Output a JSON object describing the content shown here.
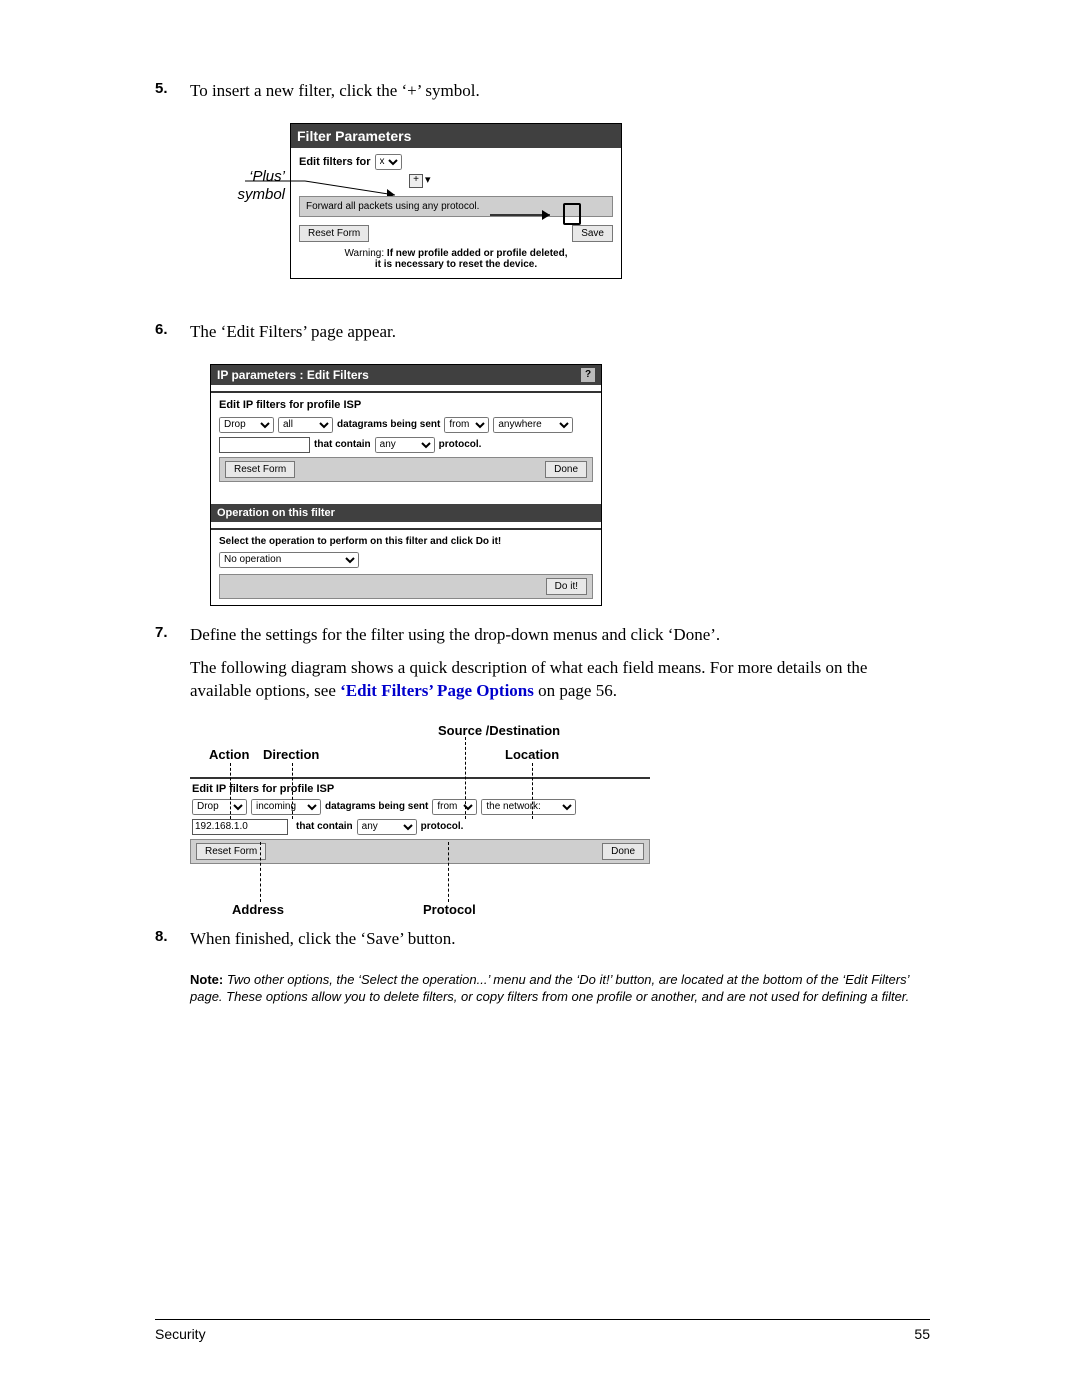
{
  "steps": {
    "s5": {
      "num": "5.",
      "text": "To insert a new filter, click the ‘+’ symbol."
    },
    "s6": {
      "num": "6.",
      "text": "The ‘Edit Filters’ page appear."
    },
    "s7": {
      "num": "7.",
      "text1": "Define the settings for the filter using the drop-down menus and click ‘Done’.",
      "text2a": "The following diagram shows a quick description of what each field means. For more details on the available options, see ",
      "link": "‘Edit Filters’ Page Options",
      "text2b": " on page 56."
    },
    "s8": {
      "num": "8.",
      "text": "When finished, click the ‘Save’ button."
    }
  },
  "fig1": {
    "callout_line1": "‘Plus’",
    "callout_line2": "symbol",
    "panel_title": "Filter Parameters",
    "edit_filters_for": "Edit filters for",
    "edit_select_value": "x",
    "plus": "+",
    "gray_text": "Forward all packets using any protocol.",
    "reset_btn": "Reset Form",
    "save_btn": "Save",
    "warn_label": "Warning:",
    "warn_line1": "If new profile added or profile deleted,",
    "warn_line2": "it is necessary to reset the device."
  },
  "fig2": {
    "title": "IP parameters : Edit Filters",
    "help": "?",
    "heading": "Edit IP filters for profile ISP",
    "action_value": "Drop",
    "dir_value": "all",
    "dgs": "datagrams being sent",
    "fromto_value": "from",
    "loc_value": "anywhere",
    "addr_value": "",
    "that_contain": "that contain",
    "proto_value": "any",
    "proto_label": "protocol.",
    "reset_btn": "Reset Form",
    "done_btn": "Done",
    "op_header": "Operation on this filter",
    "op_instr": "Select the operation to perform on this filter and click Do it!",
    "op_value": "No operation",
    "doit_btn": "Do it!"
  },
  "fig3": {
    "lbl_action": "Action",
    "lbl_direction": "Direction",
    "lbl_srcdst": "Source /Destination",
    "lbl_location": "Location",
    "lbl_address": "Address",
    "lbl_protocol": "Protocol",
    "heading": "Edit IP filters for profile ISP",
    "action_value": "Drop",
    "dir_value": "incoming",
    "dgs": "datagrams being sent",
    "fromto_value": "from",
    "loc_value": "the network:",
    "addr_value": "192.168.1.0",
    "that_contain": "that contain",
    "proto_value": "any",
    "proto_label": "protocol.",
    "reset_btn": "Reset Form",
    "done_btn": "Done"
  },
  "note": {
    "label": "Note:",
    "text": "Two other options, the ‘Select the operation...’ menu and the ‘Do it!’ button, are located at the bottom of the ‘Edit Filters’ page. These options allow you to delete filters, or copy filters from one profile or another, and are not used for defining a filter."
  },
  "footer": {
    "left": "Security",
    "right": "55"
  }
}
